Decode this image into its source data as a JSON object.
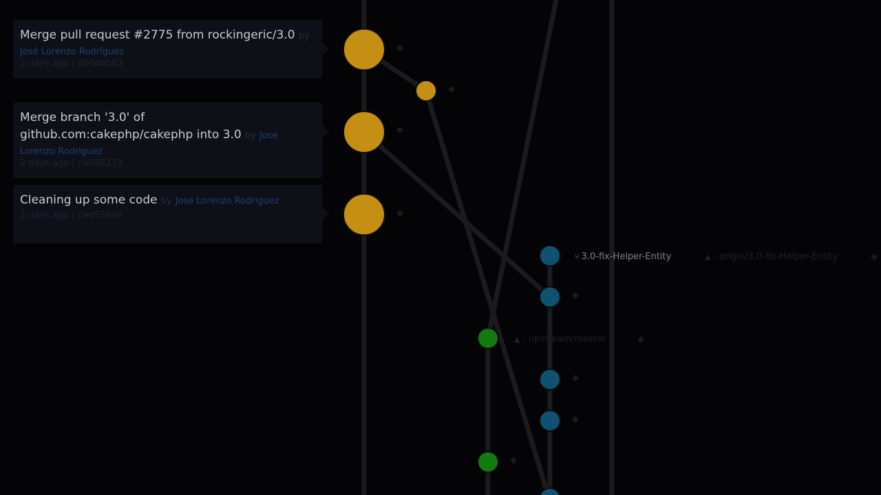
{
  "commits": [
    {
      "message": "Merge pull request #2775 from rockingeric/3.0",
      "by": "by",
      "author": "José Lorenzo Rodríguez",
      "age": "2 days ago",
      "sep": "|",
      "hash": "d90abb83"
    },
    {
      "message": "Merge branch '3.0' of github.com:cakephp/cakephp into 3.0",
      "by": "by",
      "author": "Jose Lorenzo Rodriguez",
      "age": "2 days ago",
      "sep": "|",
      "hash": "c4038273"
    },
    {
      "message": "Cleaning up some code",
      "by": "by",
      "author": "Jose Lorenzo Rodriguez",
      "age": "2 days ago",
      "sep": "|",
      "hash": "cad53640"
    }
  ],
  "refs": {
    "local_branch": "3.0-fix-Helper-Entity",
    "remote_branch": "origin/3.0-fix-Helper-Entity",
    "upstream": "upstream/master",
    "warning_icon": "▲",
    "branch_icon": "⑂"
  },
  "colors": {
    "yellow": "#c48f12",
    "blue": "#0f5170",
    "green": "#137a10",
    "line": "#1b1b1d"
  }
}
